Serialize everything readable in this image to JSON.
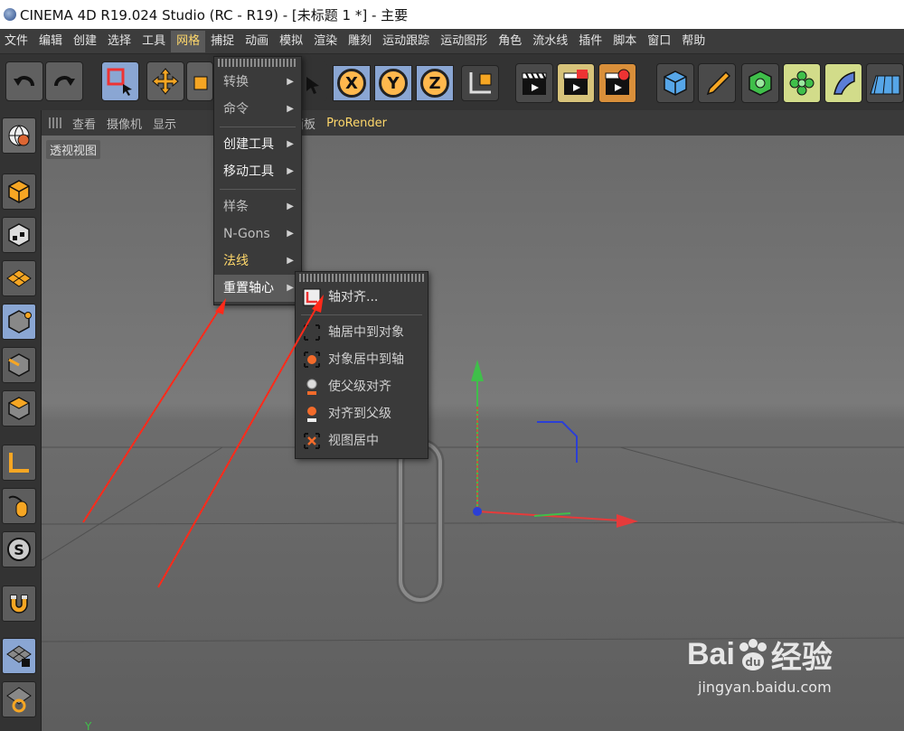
{
  "titlebar": {
    "title": "CINEMA 4D R19.024 Studio (RC - R19) - [未标题 1 *] - 主要"
  },
  "menubar": {
    "items": [
      "文件",
      "编辑",
      "创建",
      "选择",
      "工具",
      "网格",
      "捕捉",
      "动画",
      "模拟",
      "渲染",
      "雕刻",
      "运动跟踪",
      "运动图形",
      "角色",
      "流水线",
      "插件",
      "脚本",
      "窗口",
      "帮助"
    ],
    "active_index": 5
  },
  "viewport_header": {
    "items": [
      "查看",
      "摄像机",
      "显示",
      "面板",
      "ProRender"
    ]
  },
  "viewport": {
    "label": "透视视图",
    "axis_bottom_label": "Y"
  },
  "mesh_menu": {
    "items": [
      {
        "label": "转换",
        "submenu": true
      },
      {
        "label": "命令",
        "submenu": true
      },
      {
        "label": "创建工具",
        "submenu": true
      },
      {
        "label": "移动工具",
        "submenu": true
      },
      {
        "label": "样条",
        "submenu": true
      },
      {
        "label": "N-Gons",
        "submenu": true
      },
      {
        "label": "法线",
        "submenu": true
      },
      {
        "label": "重置轴心",
        "submenu": true
      }
    ],
    "selected_index": 7
  },
  "axis_submenu": {
    "items": [
      "轴对齐...",
      "轴居中到对象",
      "对象居中到轴",
      "使父级对齐",
      "对齐到父级",
      "视图居中"
    ]
  },
  "toolbar": {
    "axis_labels": [
      "X",
      "Y",
      "Z"
    ]
  },
  "watermark": {
    "brand": "Bai",
    "brand_suffix": "经验",
    "url": "jingyan.baidu.com"
  },
  "colors": {
    "active_menu_text": "#ffd86b",
    "x_axis": "#e53b3b",
    "y_axis": "#3fbf4a",
    "z_axis": "#2b3fd6",
    "annotation_arrow": "#ff2a1a"
  }
}
